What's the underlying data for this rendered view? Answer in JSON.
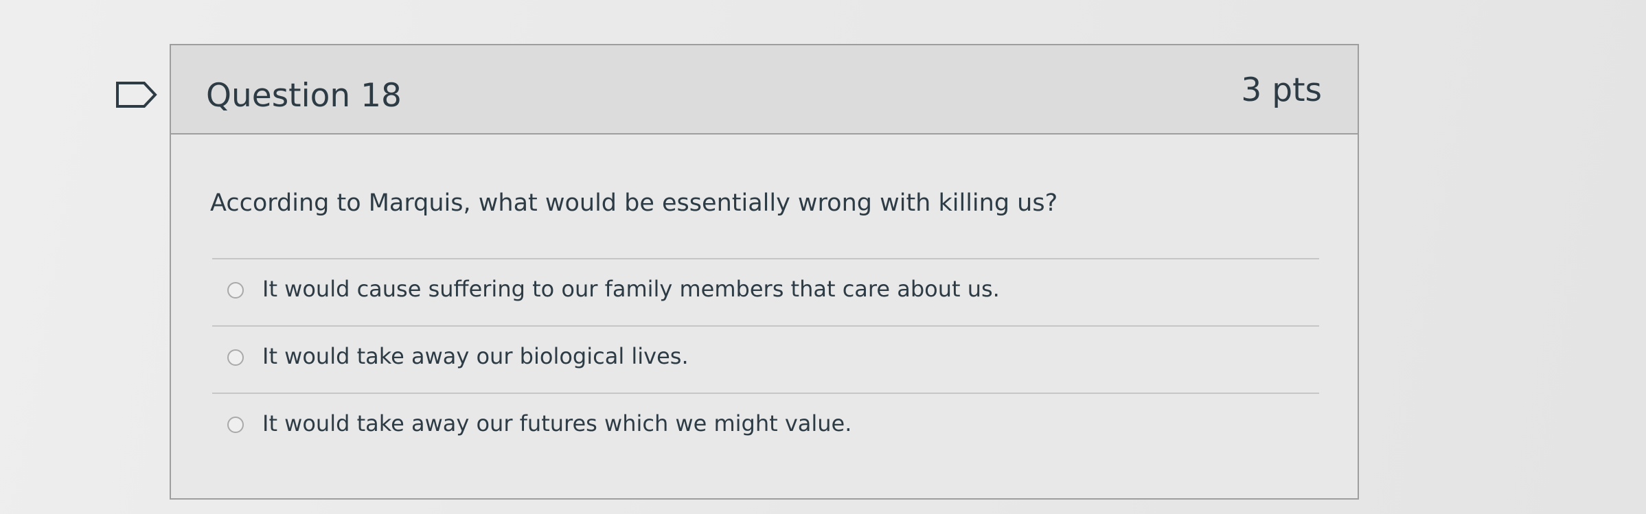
{
  "question": {
    "title": "Question 18",
    "points": "3 pts",
    "text": "According to Marquis, what would be essentially wrong with killing us?",
    "flag_icon": "flag-outline-icon",
    "answers": [
      {
        "label": "It would cause suffering to our family members that care about us.",
        "selected": false
      },
      {
        "label": "It would take away our biological lives.",
        "selected": false
      },
      {
        "label": "It would take away our futures which we might value.",
        "selected": false
      }
    ]
  },
  "colors": {
    "text": "#2d3b45",
    "header_bg": "#dcdcdc",
    "border": "#9e9e9e"
  }
}
